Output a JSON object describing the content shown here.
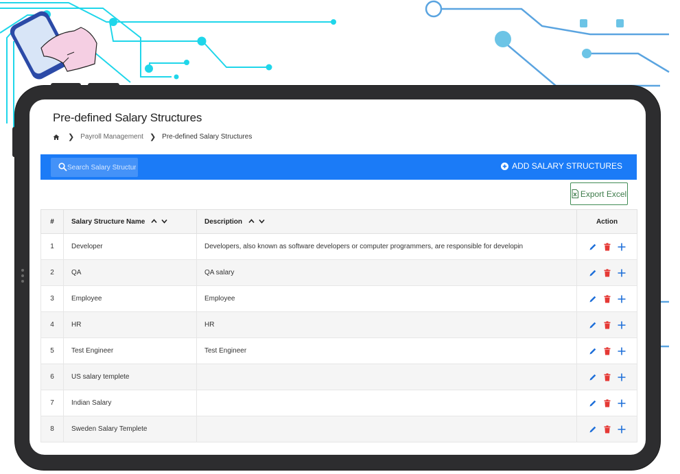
{
  "page": {
    "title": "Pre-defined Salary Structures"
  },
  "breadcrumb": {
    "items": [
      "Payroll Management",
      "Pre-defined Salary Structures"
    ]
  },
  "toolbar": {
    "search_placeholder": "Search Salary Structures",
    "add_label": "ADD SALARY STRUCTURES",
    "export_label": "Export Excel"
  },
  "table": {
    "headers": [
      "#",
      "Salary Structure Name",
      "Description",
      "Action"
    ],
    "rows": [
      {
        "num": "1",
        "name": "Developer",
        "description": "Developers, also known as software developers or computer programmers, are responsible for developin"
      },
      {
        "num": "2",
        "name": "QA",
        "description": "QA salary"
      },
      {
        "num": "3",
        "name": "Employee",
        "description": "Employee"
      },
      {
        "num": "4",
        "name": "HR",
        "description": "HR"
      },
      {
        "num": "5",
        "name": "Test Engineer",
        "description": "Test Engineer"
      },
      {
        "num": "6",
        "name": "US salary templete",
        "description": ""
      },
      {
        "num": "7",
        "name": "Indian Salary",
        "description": ""
      },
      {
        "num": "8",
        "name": "Sweden Salary Templete",
        "description": ""
      }
    ]
  },
  "icons": {
    "edit": "pencil-icon",
    "delete": "trash-icon",
    "add": "plus-icon",
    "home": "home-icon",
    "search": "search-icon",
    "export": "excel-icon"
  },
  "colors": {
    "primary": "#1b7bf7",
    "edit_icon": "#1e6fd9",
    "delete_icon": "#e53935",
    "export_border": "#3f8b53",
    "circuit": "#1fd6ea",
    "circuit_blue": "#5aa4e0"
  }
}
